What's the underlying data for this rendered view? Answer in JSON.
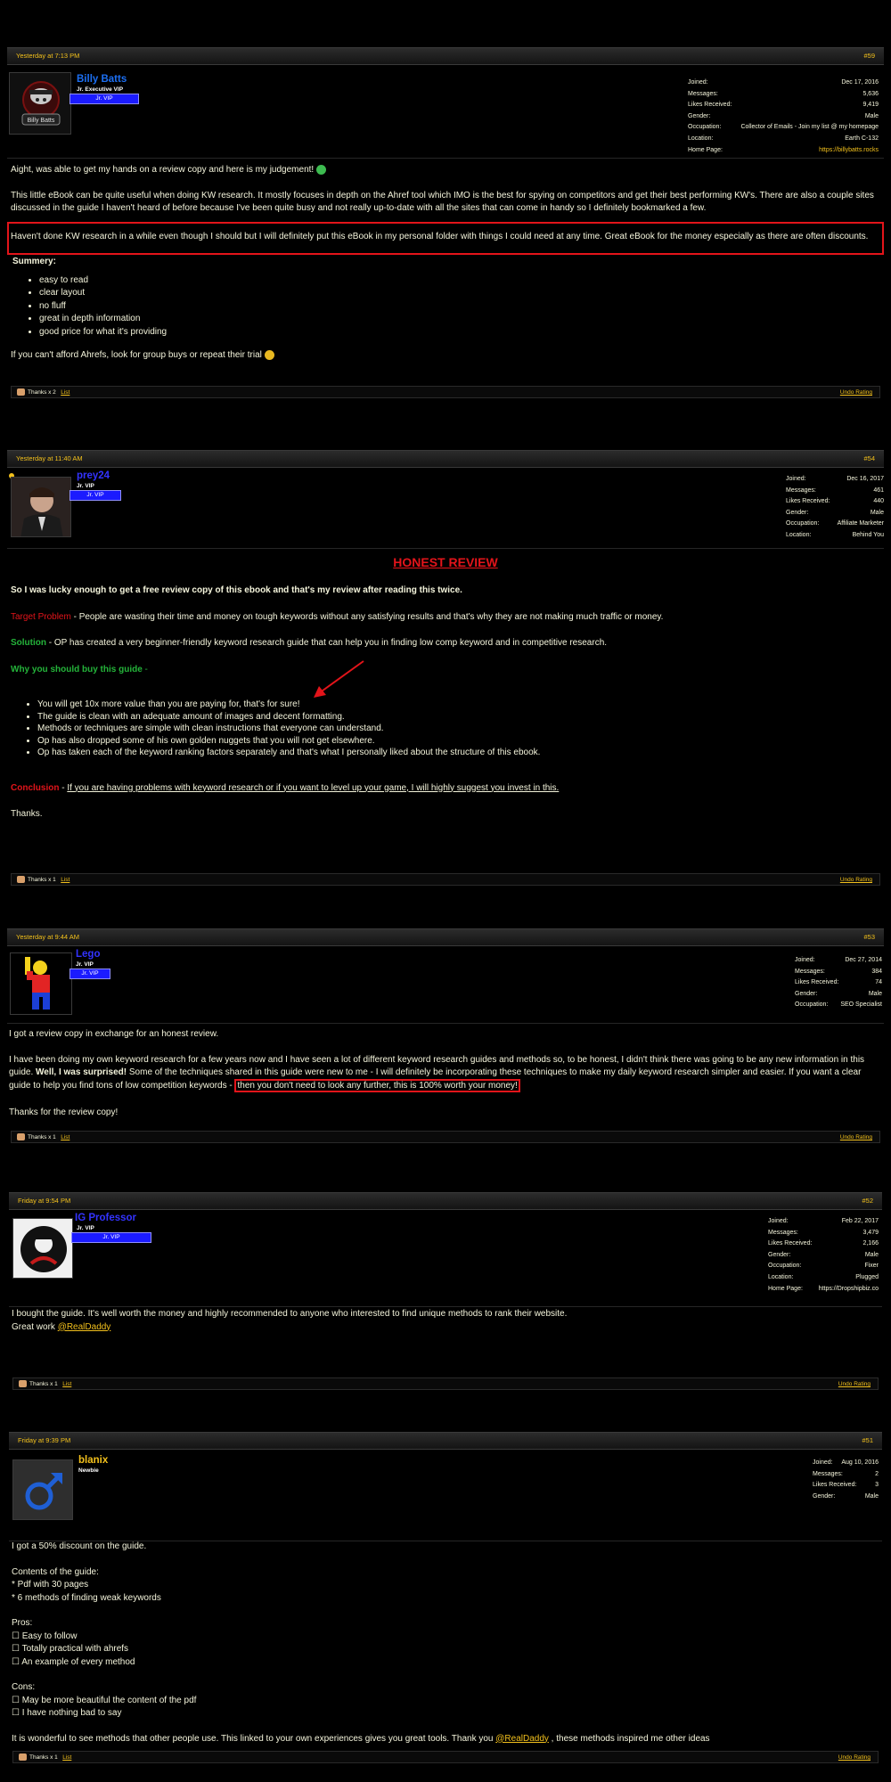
{
  "colors": {
    "accent": "#f2c01c",
    "highlight_red": "#e3141a",
    "rank_blue": "#1b1bff",
    "link_blue": "#1c6ff2",
    "name_blue": "#3333ff",
    "green": "#24b43a"
  },
  "posts": [
    {
      "time": "Yesterday at 7:13 PM",
      "number": "#59",
      "username": "Billy Batts",
      "usertitle": "Jr. Executive VIP",
      "rank": "Jr. VIP",
      "avatar_label": "Billy Batts",
      "stats": [
        {
          "label": "Joined:",
          "value": "Dec 17, 2016"
        },
        {
          "label": "Messages:",
          "value": "5,636"
        },
        {
          "label": "Likes Received:",
          "value": "9,419"
        },
        {
          "label": "Gender:",
          "value": "Male"
        },
        {
          "label": "Occupation:",
          "value": "Collector of Emails - Join my list @ my homepage"
        },
        {
          "label": "Location:",
          "value": "Earth C-132"
        },
        {
          "label": "Home Page:",
          "value": "https://billybatts.rocks"
        }
      ],
      "p1": "Aight, was able to get my hands on a review copy and here is my judgement!",
      "p2": "This little eBook can be quite useful when doing KW research. It mostly focuses in depth on the Ahref tool which IMO is the best for spying on competitors and get their best performing KW's. There are also a couple sites discussed in the guide I haven't heard of before because I've been quite busy and not really up-to-date with all the sites that can come in handy so I definitely bookmarked a few.",
      "p3": "Haven't done KW research in a while even though I should but I will definitely put this eBook in my personal folder with things I could need at any time. Great eBook for the money especially as there are often discounts.",
      "summary_title": "Summery:",
      "summary": [
        "easy to read",
        "clear layout",
        "no fluff",
        "great in depth information",
        "good price for what it's providing"
      ],
      "p4": "If you can't afford Ahrefs, look for group buys or repeat their trial",
      "thanks": "Thanks x 2",
      "list": "List",
      "undo": "Undo Rating"
    },
    {
      "time": "Yesterday at 11:40 AM",
      "number": "#54",
      "username": "prey24",
      "usertitle": "Jr. VIP",
      "rank": "Jr. VIP",
      "stats": [
        {
          "label": "Joined:",
          "value": "Dec 16, 2017"
        },
        {
          "label": "Messages:",
          "value": "461"
        },
        {
          "label": "Likes Received:",
          "value": "440"
        },
        {
          "label": "Gender:",
          "value": "Male"
        },
        {
          "label": "Occupation:",
          "value": "Affiliate Marketer"
        },
        {
          "label": "Location:",
          "value": "Behind You"
        }
      ],
      "heading": "HONEST REVIEW",
      "intro": "So I was lucky enough to get a free review copy of this ebook and that's my review after reading this twice.",
      "target_label": "Target Problem",
      "target_text": " - People are wasting their time and money on tough keywords without any satisfying results and that's why they are not making much traffic or money.",
      "solution_label": "Solution",
      "solution_text": " - OP has created a very beginner-friendly keyword research guide that can help you in finding low comp keyword and in competitive research.",
      "why_label": "Why you should buy this guide",
      "why_suffix": " -",
      "bullets": [
        "You will get 10x more value than you are paying for, that's for sure!",
        "The guide is clean with an adequate amount of images and decent formatting.",
        "Methods or techniques are simple with clean instructions that everyone can understand.",
        "Op has also dropped some of his own golden nuggets that you will not get elsewhere.",
        "Op has taken each of the keyword ranking factors separately and that's what I personally liked about the structure of this ebook."
      ],
      "conclusion_label": "Conclusion",
      "conclusion_dash": " - ",
      "conclusion_text": "If you are having problems with keyword research or if you want to level up your game, I will highly suggest you invest in this.",
      "thanks_text": "Thanks.",
      "thanks": "Thanks x 1",
      "list": "List",
      "undo": "Undo Rating"
    },
    {
      "time": "Yesterday at 9:44 AM",
      "number": "#53",
      "username": "Lego",
      "usertitle": "Jr. VIP",
      "rank": "Jr. VIP",
      "stats": [
        {
          "label": "Joined:",
          "value": "Dec 27, 2014"
        },
        {
          "label": "Messages:",
          "value": "384"
        },
        {
          "label": "Likes Received:",
          "value": "74"
        },
        {
          "label": "Gender:",
          "value": "Male"
        },
        {
          "label": "Occupation:",
          "value": "SEO Specialist"
        }
      ],
      "p1": "I got a review copy in exchange for an honest review.",
      "p2a": "I have been doing my own keyword research for a few years now and I have seen a lot of different keyword research guides and methods so, to be honest, I didn't think there was going to be any new information in this guide. ",
      "p2b": "Well, I was surprised!",
      "p2c": " Some of the techniques shared in this guide were new to me - I will definitely be incorporating these techniques to make my daily keyword research simpler and easier. If you want a clear guide to help you find tons of low competition keywords - ",
      "p2d": "then you don't need to look any further, this is 100% worth your money!",
      "p3": "Thanks for the review copy!",
      "thanks": "Thanks x 1",
      "list": "List",
      "undo": "Undo Rating"
    },
    {
      "time": "Friday at 9:54 PM",
      "number": "#52",
      "username": "IG Professor",
      "usertitle": "Jr. VIP",
      "rank": "Jr. VIP",
      "stats": [
        {
          "label": "Joined:",
          "value": "Feb 22, 2017"
        },
        {
          "label": "Messages:",
          "value": "3,479"
        },
        {
          "label": "Likes Received:",
          "value": "2,166"
        },
        {
          "label": "Gender:",
          "value": "Male"
        },
        {
          "label": "Occupation:",
          "value": "Fixer"
        },
        {
          "label": "Location:",
          "value": "Plugged"
        },
        {
          "label": "Home Page:",
          "value": "https://Dropshipbiz.co"
        }
      ],
      "p1": "I bought the guide. It's well worth the money and highly recommended to anyone who interested to find unique methods to rank their website.",
      "p2": "Great work ",
      "mention": "@RealDaddy",
      "thanks": "Thanks x 1",
      "list": "List",
      "undo": "Undo Rating"
    },
    {
      "time": "Friday at 9:39 PM",
      "number": "#51",
      "username": "blanix",
      "usertitle": "Newbie",
      "stats": [
        {
          "label": "Joined:",
          "value": "Aug 10, 2016"
        },
        {
          "label": "Messages:",
          "value": "2"
        },
        {
          "label": "Likes Received:",
          "value": "3"
        },
        {
          "label": "Gender:",
          "value": "Male"
        }
      ],
      "p1": "I got a 50% discount on the guide.",
      "contents_title": "Contents of the guide:",
      "contents": [
        "* Pdf with 30 pages",
        "* 6 methods of finding weak keywords"
      ],
      "pros_title": "Pros:",
      "pros": [
        "☐ Easy to follow",
        "☐ Totally practical with ahrefs",
        "☐ An example of every method"
      ],
      "cons_title": "Cons:",
      "cons": [
        "☐ May be more beautiful the content of the pdf",
        "☐ I have nothing bad to say"
      ],
      "final_a": "It is wonderful to see methods that other people use. This linked to your own experiences gives you great tools. Thank you ",
      "final_mention": "@RealDaddy",
      "final_b": " , these methods inspired me other ideas",
      "thanks": "Thanks x 1",
      "list": "List",
      "undo": "Undo Rating"
    }
  ]
}
